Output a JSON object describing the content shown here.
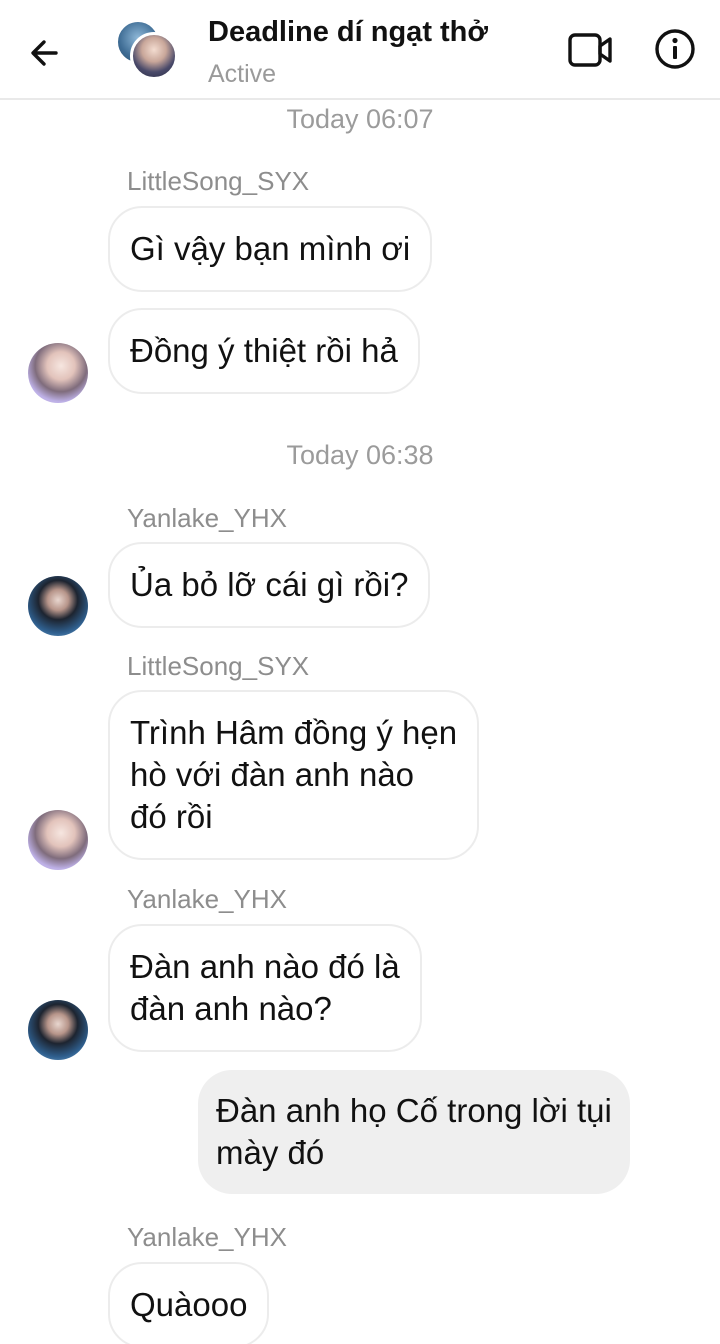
{
  "header": {
    "title": "Deadline dí ngạt thở",
    "status": "Active"
  },
  "messages": [
    {
      "timestamp": "Today 06:07"
    },
    {
      "sender": "LittleSong_SYX",
      "lines": [
        "Gì vậy bạn mình ơi"
      ]
    },
    {
      "lines": [
        "Đồng ý thiệt rồi hả"
      ]
    },
    {
      "timestamp": "Today 06:38"
    },
    {
      "sender": "Yanlake_YHX",
      "lines": [
        "Ủa bỏ lỡ cái gì rồi?"
      ]
    },
    {
      "sender": "LittleSong_SYX",
      "lines": [
        "Trình Hâm đồng ý hẹn",
        "hò với đàn anh nào",
        "đó rồi"
      ]
    },
    {
      "sender": "Yanlake_YHX",
      "lines": [
        "Đàn anh nào đó là",
        "đàn anh nào?"
      ]
    },
    {
      "lines": [
        "Đàn anh họ Cố trong lời tụi",
        "mày đó"
      ]
    },
    {
      "sender": "Yanlake_YHX",
      "lines": [
        "Quàooo"
      ]
    }
  ],
  "icons": {
    "back": "back-arrow-icon",
    "video": "video-call-icon",
    "info": "info-icon"
  },
  "colors": {
    "incoming_bubble": "#ffffff",
    "outgoing_bubble": "#efefef",
    "meta_text": "#9b9b9b"
  }
}
